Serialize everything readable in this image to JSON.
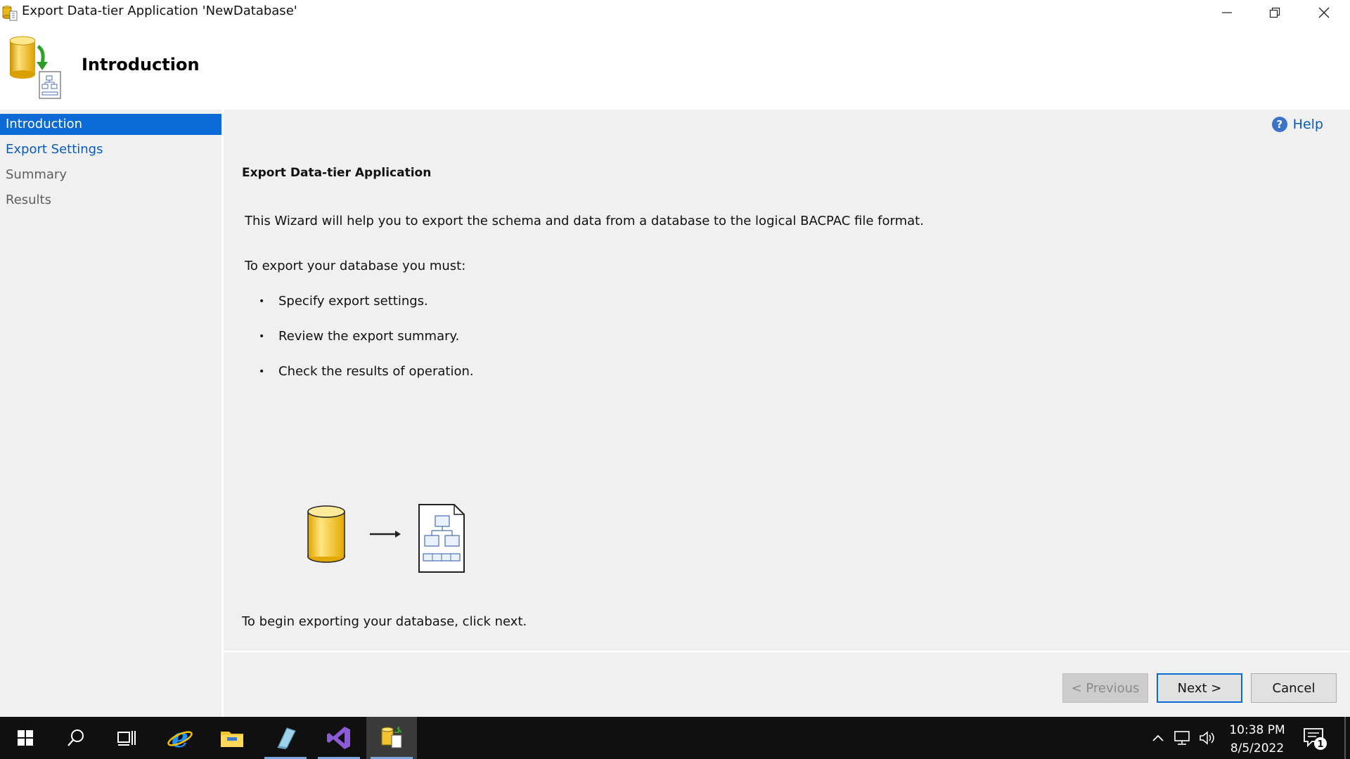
{
  "window": {
    "title": "Export Data-tier Application 'NewDatabase'",
    "controls": [
      "minimize-icon",
      "restore-icon",
      "close-icon"
    ]
  },
  "header": {
    "title": "Introduction"
  },
  "sidebar": {
    "items": [
      {
        "label": "Introduction",
        "state": "active"
      },
      {
        "label": "Export Settings",
        "state": "link"
      },
      {
        "label": "Summary",
        "state": "disabled"
      },
      {
        "label": "Results",
        "state": "disabled"
      }
    ]
  },
  "main": {
    "help_label": "Help",
    "heading": "Export Data-tier Application",
    "intro": "This Wizard will help you to export the schema and data from a database to the logical BACPAC file format.",
    "must_text": "To export your database you must:",
    "bullets": [
      "Specify export settings.",
      "Review the export summary.",
      "Check the results of operation."
    ],
    "begin_text": "To begin exporting your database, click next."
  },
  "footer": {
    "previous_label": "< Previous",
    "next_label": "Next >",
    "cancel_label": "Cancel"
  },
  "taskbar": {
    "apps": [
      "windows-start-icon",
      "search-icon",
      "task-view-icon",
      "internet-explorer-icon",
      "file-explorer-icon",
      "sql-server-management-studio-icon",
      "visual-studio-icon",
      "export-wizard-app-icon"
    ],
    "time": "10:38 PM",
    "date": "8/5/2022",
    "notification_count": "1"
  },
  "colors": {
    "accent": "#0a6ad6",
    "link": "#0b5cb8",
    "panel": "#f0f0f0",
    "taskbar": "#101010"
  }
}
